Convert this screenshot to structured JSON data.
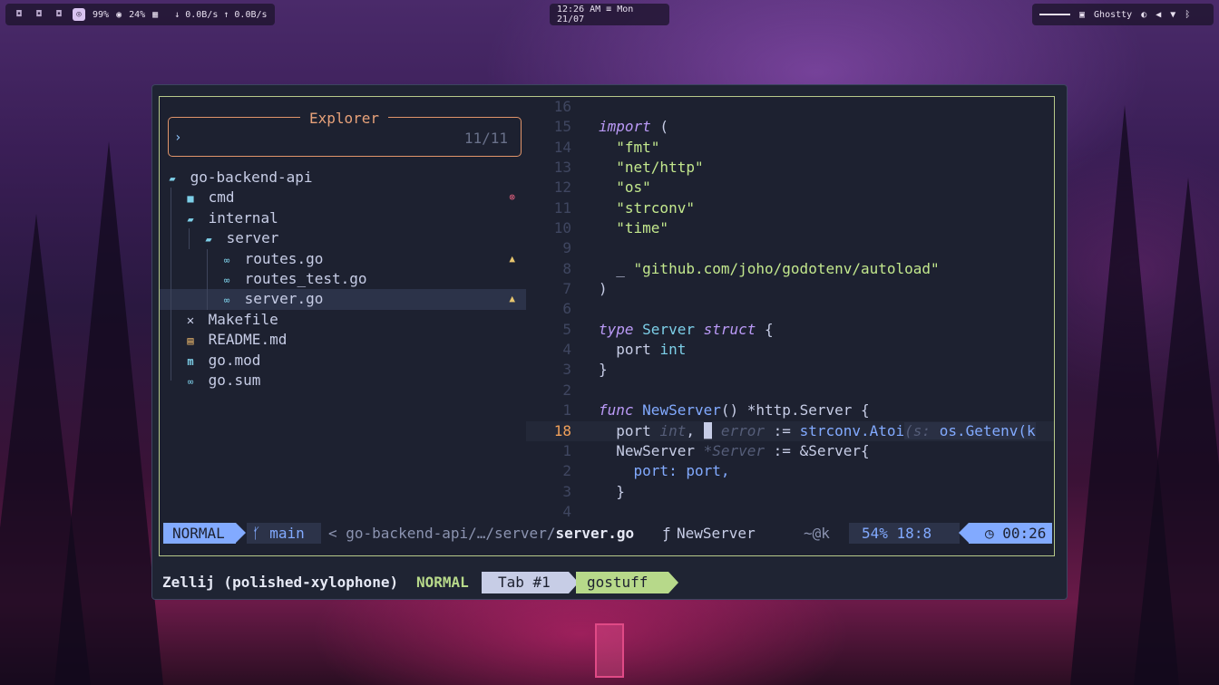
{
  "topbar": {
    "workspaces": [
      "◘",
      "◘",
      "◘",
      "◎"
    ],
    "battery": "99%",
    "cpu": "24%",
    "net": "↓ 0.0B/s ↑ 0.0B/s",
    "clock": "12:26 AM ≡ Mon 21/07",
    "app_name": "Ghostty"
  },
  "explorer": {
    "title": "Explorer",
    "prompt": "›",
    "count": "11/11"
  },
  "tree": [
    {
      "label": "go-backend-api",
      "icon": "folder-open-icon"
    },
    {
      "label": "cmd",
      "icon": "folder-icon",
      "diag": "error"
    },
    {
      "label": "internal",
      "icon": "folder-open-icon"
    },
    {
      "label": "server",
      "icon": "folder-open-icon"
    },
    {
      "label": "routes.go",
      "icon": "go-file-icon",
      "diag": "warning"
    },
    {
      "label": "routes_test.go",
      "icon": "go-file-icon"
    },
    {
      "label": "server.go",
      "icon": "go-file-icon",
      "diag": "warning",
      "selected": true
    },
    {
      "label": "Makefile",
      "icon": "makefile-icon"
    },
    {
      "label": "README.md",
      "icon": "readme-icon"
    },
    {
      "label": "go.mod",
      "icon": "gomod-icon"
    },
    {
      "label": "go.sum",
      "icon": "go-file-icon"
    }
  ],
  "code": {
    "line_numbers": [
      "16",
      "15",
      "14",
      "13",
      "12",
      "11",
      "10",
      "9",
      "8",
      "7",
      "6",
      "5",
      "4",
      "3",
      "2",
      "1",
      "18",
      "1",
      "2",
      "3",
      "4"
    ],
    "tokens": {
      "import": "import",
      "open_paren": " (",
      "fmt": "\"fmt\"",
      "net_http": "\"net/http\"",
      "os": "\"os\"",
      "strconv": "\"strconv\"",
      "time": "\"time\"",
      "underscore": "_ ",
      "godotenv": "\"github.com/joho/godotenv/autoload\"",
      "close_paren": ")",
      "type": "type",
      "server": "Server",
      "struct": "struct",
      "open_brace": " {",
      "port": "port",
      "int": "int",
      "close_brace": "}",
      "func": "func",
      "newserver": "NewServer",
      "sig_rest": "() *http.Server {",
      "port18": "port",
      "hint_int": " int",
      "comma": ", ",
      "cursor": "_",
      "hint_error": " error",
      "assign": " := ",
      "atoi": "strconv.Atoi",
      "hint_s": "(s:",
      "getenv": " os.Getenv(k",
      "newserver2": "NewServer",
      "hint_server": " *Server",
      "assign2": " := &Server{",
      "port_field": "port: port,",
      "close_brace2": "}"
    }
  },
  "status": {
    "mode": "NORMAL",
    "branch": "main",
    "path_prefix": "<  go-backend-api/…/server/",
    "path_file": "server.go",
    "symbol_icon": "ƒ",
    "function": "NewServer",
    "extra": "~@k",
    "percent": "54%",
    "position": "18:8",
    "time": "00:26"
  },
  "zellij": {
    "title": "Zellij (polished-xylophone)",
    "mode": "NORMAL",
    "tab": "Tab #1",
    "session": "gostuff"
  }
}
